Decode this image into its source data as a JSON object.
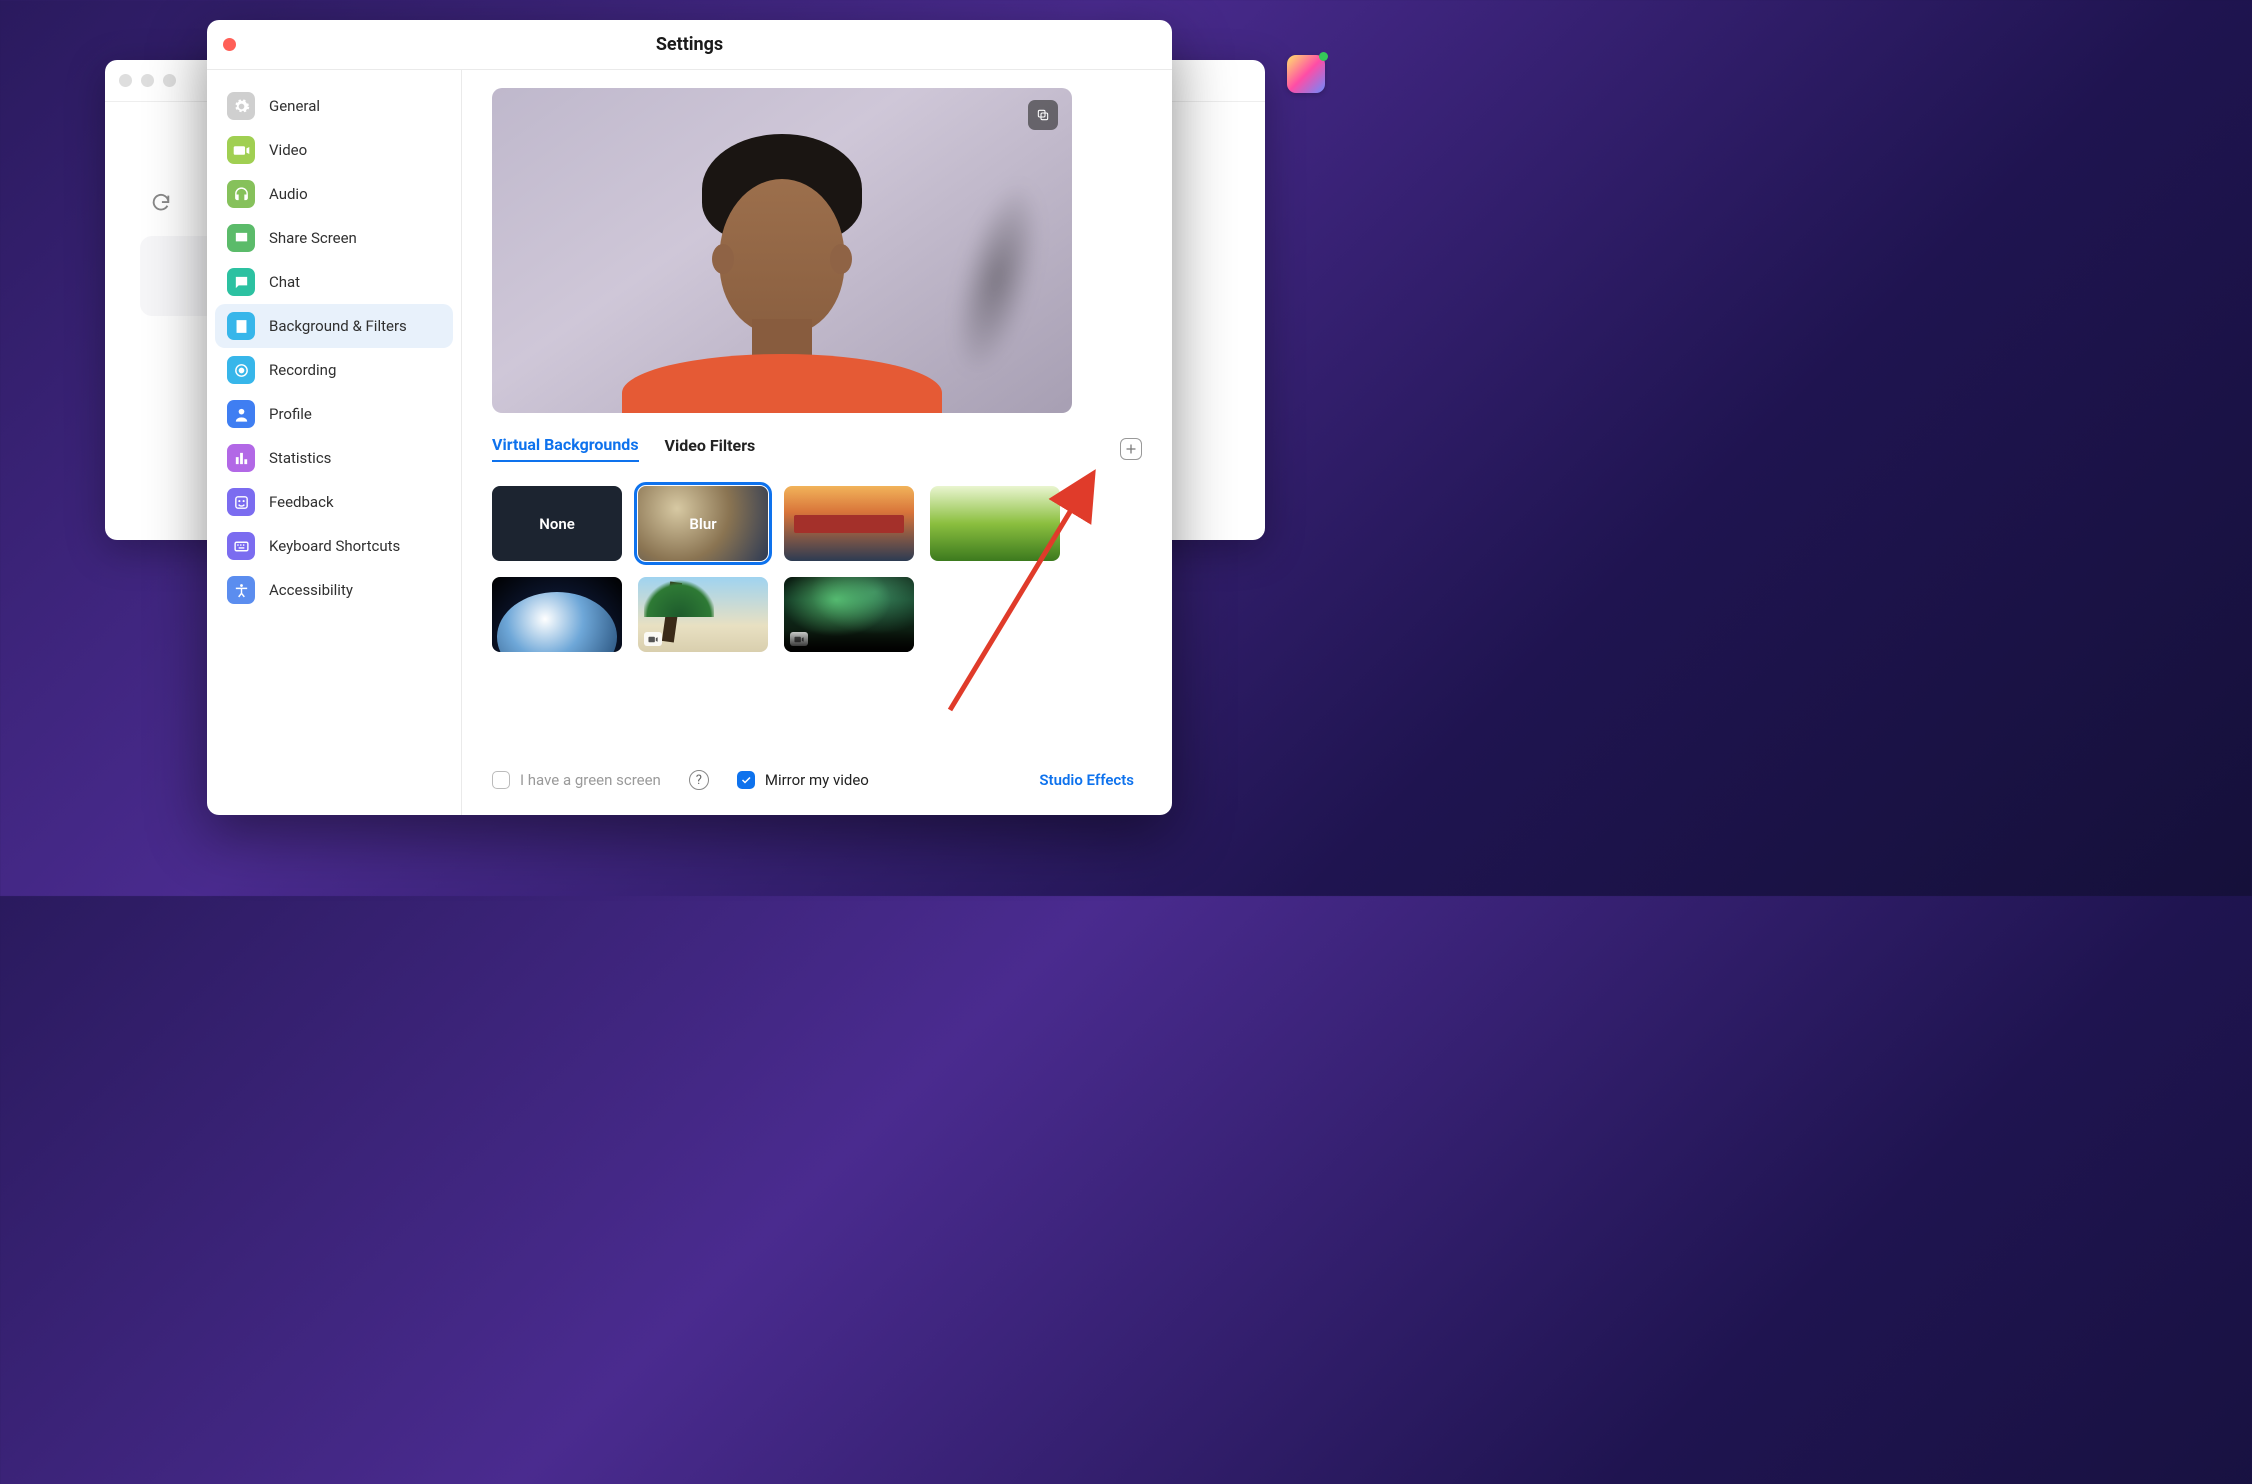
{
  "window": {
    "title": "Settings"
  },
  "sidebar": {
    "items": [
      {
        "label": "General",
        "icon": "gear",
        "color": "#cfcfcf"
      },
      {
        "label": "Video",
        "icon": "camera",
        "color": "#8bc34a"
      },
      {
        "label": "Audio",
        "icon": "headset",
        "color": "#8bc34a"
      },
      {
        "label": "Share Screen",
        "icon": "share",
        "color": "#66bb6a"
      },
      {
        "label": "Chat",
        "icon": "chat",
        "color": "#26c6a8"
      },
      {
        "label": "Background & Filters",
        "icon": "portrait",
        "color": "#35b7ec",
        "active": true
      },
      {
        "label": "Recording",
        "icon": "record",
        "color": "#35b7ec"
      },
      {
        "label": "Profile",
        "icon": "profile",
        "color": "#3f7ef2"
      },
      {
        "label": "Statistics",
        "icon": "stats",
        "color": "#b268e6"
      },
      {
        "label": "Feedback",
        "icon": "feedback",
        "color": "#7b6cf0"
      },
      {
        "label": "Keyboard Shortcuts",
        "icon": "keyboard",
        "color": "#7b6cf0"
      },
      {
        "label": "Accessibility",
        "icon": "a11y",
        "color": "#5b8def"
      }
    ]
  },
  "tabs": {
    "virtual_backgrounds": "Virtual Backgrounds",
    "video_filters": "Video Filters",
    "active": "virtual_backgrounds"
  },
  "backgrounds": [
    {
      "id": "none",
      "label": "None",
      "has_label": true
    },
    {
      "id": "blur",
      "label": "Blur",
      "has_label": true,
      "selected": true
    },
    {
      "id": "bridge",
      "label": "",
      "has_label": false
    },
    {
      "id": "grass",
      "label": "",
      "has_label": false
    },
    {
      "id": "earth",
      "label": "",
      "has_label": false
    },
    {
      "id": "beach",
      "label": "",
      "has_label": false,
      "video": true
    },
    {
      "id": "aurora",
      "label": "",
      "has_label": false,
      "video": true
    }
  ],
  "footer": {
    "green_screen_label": "I have a green screen",
    "green_screen_checked": false,
    "mirror_label": "Mirror my video",
    "mirror_checked": true,
    "studio_effects": "Studio Effects"
  },
  "annotation": {
    "arrow_target": "add-background-button"
  }
}
